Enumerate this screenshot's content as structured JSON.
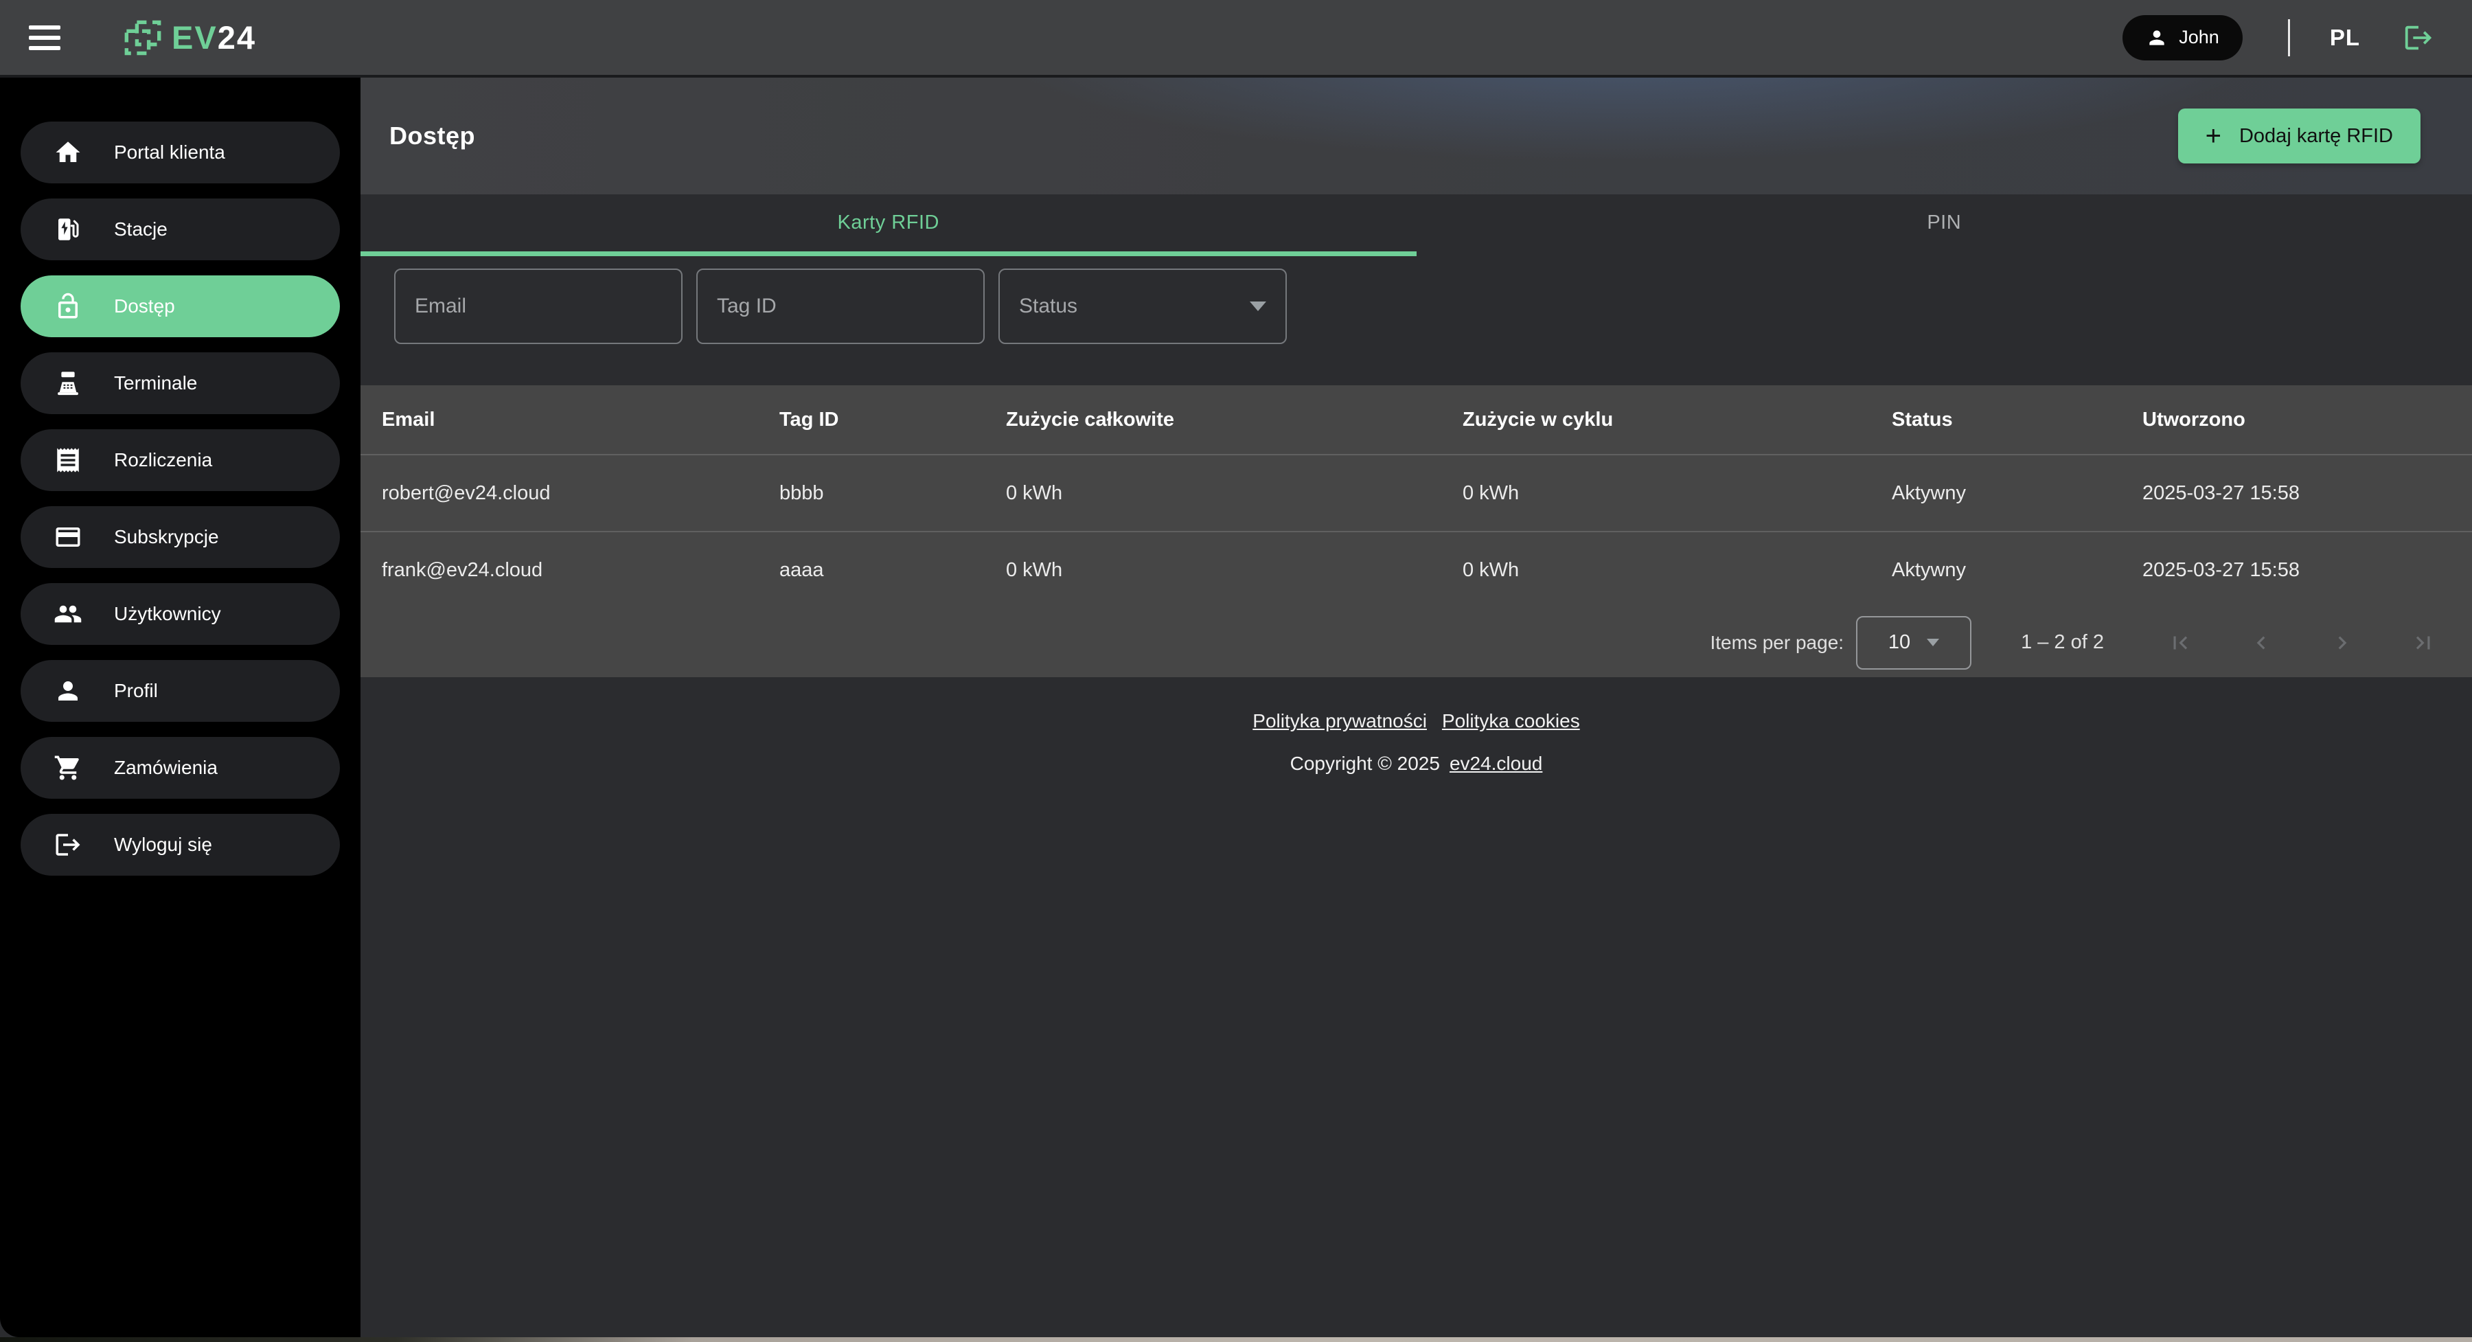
{
  "topbar": {
    "logo_ev": "EV",
    "logo_24": "24",
    "user_name": "John",
    "language": "PL"
  },
  "sidebar": {
    "items": [
      {
        "label": "Portal klienta",
        "icon": "home-icon",
        "active": false
      },
      {
        "label": "Stacje",
        "icon": "ev-station-icon",
        "active": false
      },
      {
        "label": "Dostęp",
        "icon": "lock-open-icon",
        "active": true
      },
      {
        "label": "Terminale",
        "icon": "pos-terminal-icon",
        "active": false
      },
      {
        "label": "Rozliczenia",
        "icon": "receipt-icon",
        "active": false
      },
      {
        "label": "Subskrypcje",
        "icon": "credit-card-icon",
        "active": false
      },
      {
        "label": "Użytkownicy",
        "icon": "users-icon",
        "active": false
      },
      {
        "label": "Profil",
        "icon": "person-icon",
        "active": false
      },
      {
        "label": "Zamówienia",
        "icon": "cart-icon",
        "active": false
      },
      {
        "label": "Wyloguj się",
        "icon": "logout-icon",
        "active": false
      }
    ]
  },
  "page": {
    "title": "Dostęp",
    "add_button_label": "Dodaj kartę RFID",
    "tabs": [
      {
        "label": "Karty RFID",
        "active": true
      },
      {
        "label": "PIN",
        "active": false
      }
    ],
    "filters": {
      "email_placeholder": "Email",
      "tag_placeholder": "Tag ID",
      "status_label": "Status"
    }
  },
  "table": {
    "columns": [
      "Email",
      "Tag ID",
      "Zużycie całkowite",
      "Zużycie w cyklu",
      "Status",
      "Utworzono"
    ],
    "rows": [
      {
        "email": "robert@ev24.cloud",
        "tag": "bbbb",
        "total": "0 kWh",
        "cycle": "0 kWh",
        "status": "Aktywny",
        "created": "2025-03-27 15:58"
      },
      {
        "email": "frank@ev24.cloud",
        "tag": "aaaa",
        "total": "0 kWh",
        "cycle": "0 kWh",
        "status": "Aktywny",
        "created": "2025-03-27 15:58"
      }
    ],
    "pagination": {
      "items_per_page_label": "Items per page:",
      "items_per_page_value": "10",
      "range_label": "1 – 2 of 2"
    }
  },
  "footer": {
    "privacy_link": "Polityka prywatności",
    "cookies_link": "Polityka cookies",
    "copyright": "Copyright © 2025",
    "domain_link": "ev24.cloud"
  },
  "icons": {
    "plus_glyph": "+"
  },
  "colors": {
    "accent_green": "#6fcf97",
    "sidebar_bg": "#000000",
    "topbar_bg": "#404143",
    "content_bg": "#2b2c2f",
    "table_bg": "#464646"
  }
}
